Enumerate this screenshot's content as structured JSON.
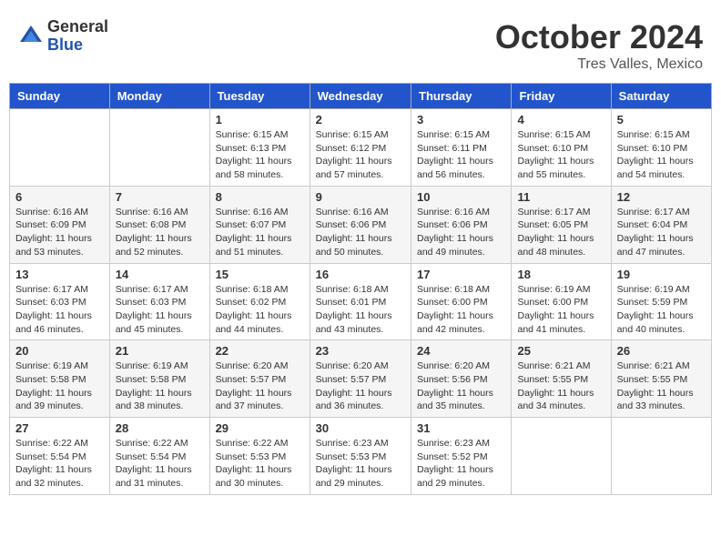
{
  "logo": {
    "general": "General",
    "blue": "Blue"
  },
  "header": {
    "month": "October 2024",
    "location": "Tres Valles, Mexico"
  },
  "weekdays": [
    "Sunday",
    "Monday",
    "Tuesday",
    "Wednesday",
    "Thursday",
    "Friday",
    "Saturday"
  ],
  "weeks": [
    [
      {
        "day": "",
        "info": ""
      },
      {
        "day": "",
        "info": ""
      },
      {
        "day": "1",
        "sunrise": "Sunrise: 6:15 AM",
        "sunset": "Sunset: 6:13 PM",
        "daylight": "Daylight: 11 hours and 58 minutes."
      },
      {
        "day": "2",
        "sunrise": "Sunrise: 6:15 AM",
        "sunset": "Sunset: 6:12 PM",
        "daylight": "Daylight: 11 hours and 57 minutes."
      },
      {
        "day": "3",
        "sunrise": "Sunrise: 6:15 AM",
        "sunset": "Sunset: 6:11 PM",
        "daylight": "Daylight: 11 hours and 56 minutes."
      },
      {
        "day": "4",
        "sunrise": "Sunrise: 6:15 AM",
        "sunset": "Sunset: 6:10 PM",
        "daylight": "Daylight: 11 hours and 55 minutes."
      },
      {
        "day": "5",
        "sunrise": "Sunrise: 6:15 AM",
        "sunset": "Sunset: 6:10 PM",
        "daylight": "Daylight: 11 hours and 54 minutes."
      }
    ],
    [
      {
        "day": "6",
        "sunrise": "Sunrise: 6:16 AM",
        "sunset": "Sunset: 6:09 PM",
        "daylight": "Daylight: 11 hours and 53 minutes."
      },
      {
        "day": "7",
        "sunrise": "Sunrise: 6:16 AM",
        "sunset": "Sunset: 6:08 PM",
        "daylight": "Daylight: 11 hours and 52 minutes."
      },
      {
        "day": "8",
        "sunrise": "Sunrise: 6:16 AM",
        "sunset": "Sunset: 6:07 PM",
        "daylight": "Daylight: 11 hours and 51 minutes."
      },
      {
        "day": "9",
        "sunrise": "Sunrise: 6:16 AM",
        "sunset": "Sunset: 6:06 PM",
        "daylight": "Daylight: 11 hours and 50 minutes."
      },
      {
        "day": "10",
        "sunrise": "Sunrise: 6:16 AM",
        "sunset": "Sunset: 6:06 PM",
        "daylight": "Daylight: 11 hours and 49 minutes."
      },
      {
        "day": "11",
        "sunrise": "Sunrise: 6:17 AM",
        "sunset": "Sunset: 6:05 PM",
        "daylight": "Daylight: 11 hours and 48 minutes."
      },
      {
        "day": "12",
        "sunrise": "Sunrise: 6:17 AM",
        "sunset": "Sunset: 6:04 PM",
        "daylight": "Daylight: 11 hours and 47 minutes."
      }
    ],
    [
      {
        "day": "13",
        "sunrise": "Sunrise: 6:17 AM",
        "sunset": "Sunset: 6:03 PM",
        "daylight": "Daylight: 11 hours and 46 minutes."
      },
      {
        "day": "14",
        "sunrise": "Sunrise: 6:17 AM",
        "sunset": "Sunset: 6:03 PM",
        "daylight": "Daylight: 11 hours and 45 minutes."
      },
      {
        "day": "15",
        "sunrise": "Sunrise: 6:18 AM",
        "sunset": "Sunset: 6:02 PM",
        "daylight": "Daylight: 11 hours and 44 minutes."
      },
      {
        "day": "16",
        "sunrise": "Sunrise: 6:18 AM",
        "sunset": "Sunset: 6:01 PM",
        "daylight": "Daylight: 11 hours and 43 minutes."
      },
      {
        "day": "17",
        "sunrise": "Sunrise: 6:18 AM",
        "sunset": "Sunset: 6:00 PM",
        "daylight": "Daylight: 11 hours and 42 minutes."
      },
      {
        "day": "18",
        "sunrise": "Sunrise: 6:19 AM",
        "sunset": "Sunset: 6:00 PM",
        "daylight": "Daylight: 11 hours and 41 minutes."
      },
      {
        "day": "19",
        "sunrise": "Sunrise: 6:19 AM",
        "sunset": "Sunset: 5:59 PM",
        "daylight": "Daylight: 11 hours and 40 minutes."
      }
    ],
    [
      {
        "day": "20",
        "sunrise": "Sunrise: 6:19 AM",
        "sunset": "Sunset: 5:58 PM",
        "daylight": "Daylight: 11 hours and 39 minutes."
      },
      {
        "day": "21",
        "sunrise": "Sunrise: 6:19 AM",
        "sunset": "Sunset: 5:58 PM",
        "daylight": "Daylight: 11 hours and 38 minutes."
      },
      {
        "day": "22",
        "sunrise": "Sunrise: 6:20 AM",
        "sunset": "Sunset: 5:57 PM",
        "daylight": "Daylight: 11 hours and 37 minutes."
      },
      {
        "day": "23",
        "sunrise": "Sunrise: 6:20 AM",
        "sunset": "Sunset: 5:57 PM",
        "daylight": "Daylight: 11 hours and 36 minutes."
      },
      {
        "day": "24",
        "sunrise": "Sunrise: 6:20 AM",
        "sunset": "Sunset: 5:56 PM",
        "daylight": "Daylight: 11 hours and 35 minutes."
      },
      {
        "day": "25",
        "sunrise": "Sunrise: 6:21 AM",
        "sunset": "Sunset: 5:55 PM",
        "daylight": "Daylight: 11 hours and 34 minutes."
      },
      {
        "day": "26",
        "sunrise": "Sunrise: 6:21 AM",
        "sunset": "Sunset: 5:55 PM",
        "daylight": "Daylight: 11 hours and 33 minutes."
      }
    ],
    [
      {
        "day": "27",
        "sunrise": "Sunrise: 6:22 AM",
        "sunset": "Sunset: 5:54 PM",
        "daylight": "Daylight: 11 hours and 32 minutes."
      },
      {
        "day": "28",
        "sunrise": "Sunrise: 6:22 AM",
        "sunset": "Sunset: 5:54 PM",
        "daylight": "Daylight: 11 hours and 31 minutes."
      },
      {
        "day": "29",
        "sunrise": "Sunrise: 6:22 AM",
        "sunset": "Sunset: 5:53 PM",
        "daylight": "Daylight: 11 hours and 30 minutes."
      },
      {
        "day": "30",
        "sunrise": "Sunrise: 6:23 AM",
        "sunset": "Sunset: 5:53 PM",
        "daylight": "Daylight: 11 hours and 29 minutes."
      },
      {
        "day": "31",
        "sunrise": "Sunrise: 6:23 AM",
        "sunset": "Sunset: 5:52 PM",
        "daylight": "Daylight: 11 hours and 29 minutes."
      },
      {
        "day": "",
        "info": ""
      },
      {
        "day": "",
        "info": ""
      }
    ]
  ]
}
